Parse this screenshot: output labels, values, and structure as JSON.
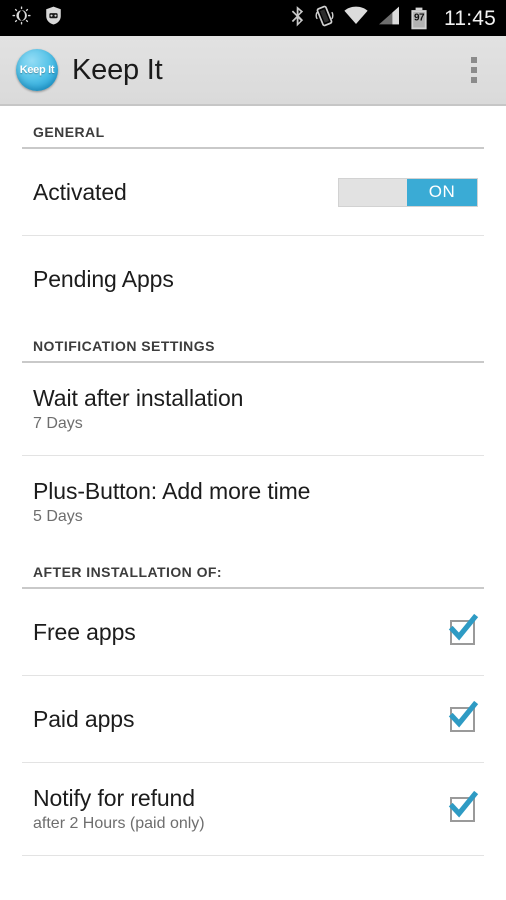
{
  "status_bar": {
    "icons_left": [
      "brightness-auto-icon",
      "privacy-guard-shield-icon"
    ],
    "icons_right": [
      "bluetooth-icon",
      "vibrate-icon",
      "wifi-icon",
      "cell-signal-icon",
      "battery-icon"
    ],
    "battery_level": "97",
    "clock": "11:45"
  },
  "action_bar": {
    "logo_text": "Keep It",
    "logo_name": "keep-it-app-logo",
    "title": "Keep It",
    "overflow_name": "overflow-menu-icon"
  },
  "sections": [
    {
      "header": "GENERAL",
      "rows": [
        {
          "title": "Activated",
          "summary": null,
          "control": "switch",
          "switch_label": "ON",
          "checked": true
        },
        {
          "title": "Pending Apps",
          "summary": null,
          "control": "none"
        }
      ]
    },
    {
      "header": "NOTIFICATION SETTINGS",
      "rows": [
        {
          "title": "Wait after installation",
          "summary": "7 Days",
          "control": "none"
        },
        {
          "title": "Plus-Button: Add more time",
          "summary": "5 Days",
          "control": "none"
        }
      ]
    },
    {
      "header": "AFTER INSTALLATION OF:",
      "rows": [
        {
          "title": "Free apps",
          "summary": null,
          "control": "checkbox",
          "checked": true
        },
        {
          "title": "Paid apps",
          "summary": null,
          "control": "checkbox",
          "checked": true
        },
        {
          "title": "Notify for refund",
          "summary": "after 2 Hours (paid only)",
          "control": "checkbox",
          "checked": true
        }
      ]
    }
  ],
  "colors": {
    "accent": "#3aabd5",
    "status_bar_bg": "#000000",
    "action_bar_bg": "#dcdcdc",
    "divider": "#e3e3e3",
    "section_divider": "#c9c9c9",
    "title_text": "#1c1c1c",
    "summary_text": "#6e6e6e"
  }
}
